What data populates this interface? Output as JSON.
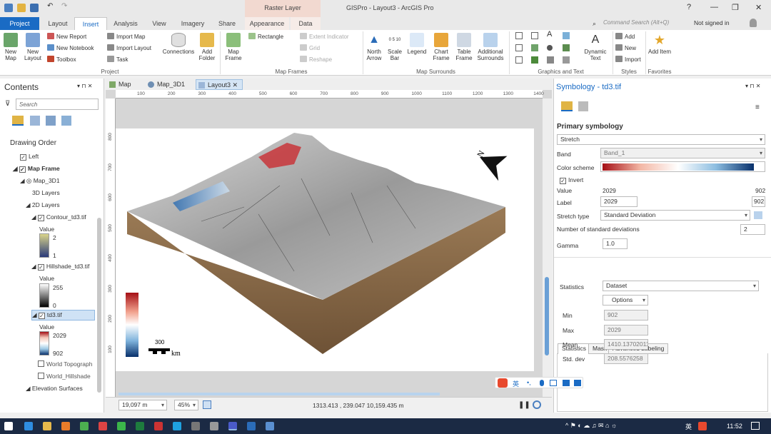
{
  "window": {
    "title": "GISPro - Layout3 - ArcGIS Pro",
    "contextual_tab_group": "Raster Layer",
    "help": "?",
    "signin": "Not signed in"
  },
  "tabs": [
    "Project",
    "Layout",
    "Insert",
    "Analysis",
    "View",
    "Imagery",
    "Share",
    "Appearance",
    "Data"
  ],
  "active_tab": "Insert",
  "command_search": {
    "placeholder": "Command Search (Alt+Q)"
  },
  "ribbon": {
    "project": {
      "new_map": "New Map",
      "new_layout": "New Layout",
      "new_report": "New Report",
      "new_notebook": "New Notebook",
      "toolbox": "Toolbox",
      "import_map": "Import Map",
      "import_layout": "Import Layout",
      "task": "Task",
      "connections": "Connections",
      "add_folder": "Add Folder",
      "group": "Project"
    },
    "map_frames": {
      "map_frame": "Map Frame",
      "rectangle": "Rectangle",
      "extent_indicator": "Extent Indicator",
      "grid": "Grid",
      "reshape": "Reshape",
      "group": "Map Frames"
    },
    "map_surrounds": {
      "north_arrow": "North Arrow",
      "scale_bar": "Scale Bar",
      "scale_bar_ticks": "0 5 10",
      "legend": "Legend",
      "chart_frame": "Chart Frame",
      "table_frame": "Table Frame",
      "additional_surrounds": "Additional Surrounds",
      "group": "Map Surrounds"
    },
    "graphics": {
      "dynamic_text": "Dynamic Text",
      "text_glyph": "A",
      "group": "Graphics and Text"
    },
    "styles": {
      "add": "Add",
      "new": "New",
      "import": "Import",
      "group": "Styles"
    },
    "favorites": {
      "add_item": "Add Item",
      "group": "Favorites"
    }
  },
  "contents": {
    "title": "Contents",
    "search_placeholder": "Search",
    "drawing_order": "Drawing Order",
    "items": {
      "left": "Left",
      "map_frame": "Map Frame",
      "map_3d1": "Map_3D1",
      "layers_3d": "3D Layers",
      "layers_2d": "2D Layers",
      "contour": "Contour_td3.tif",
      "contour_value": "Value",
      "contour_max": "2",
      "contour_min": "1",
      "hillshade": "Hillshade_td3.tif",
      "hillshade_value": "Value",
      "hillshade_max": "255",
      "hillshade_min": "0",
      "td3": "td3.tif",
      "td3_value": "Value",
      "td3_max": "2029",
      "td3_min": "902",
      "world_topo": "World Topograph",
      "world_hillshade": "World_Hillshade",
      "elevation": "Elevation Surfaces"
    }
  },
  "view_tabs": [
    "Map",
    "Map_3D1",
    "Layout3"
  ],
  "rulers": {
    "h": [
      "100",
      "200",
      "300",
      "400",
      "500",
      "600",
      "700",
      "800",
      "900",
      "1000",
      "1100",
      "1200",
      "1300",
      "1400"
    ],
    "v": [
      "800",
      "700",
      "600",
      "500",
      "400",
      "300",
      "200",
      "100"
    ]
  },
  "layout": {
    "north_label": "N",
    "scale_label": "300",
    "scale_unit": "km"
  },
  "status": {
    "scale": "19,097 m",
    "zoom": "45%",
    "coords": "1313.413 , 239.047  10,159.435 m"
  },
  "symbology": {
    "title": "Symbology - td3.tif",
    "primary": "Primary symbology",
    "renderer": "Stretch",
    "band_label": "Band",
    "band": "Band_1",
    "color_scheme_label": "Color scheme",
    "invert_label": "Invert",
    "value_label": "Value",
    "value_high": "2029",
    "value_low": "902",
    "label_label": "Label",
    "label_high": "2029",
    "label_low": "902",
    "stretch_type_label": "Stretch type",
    "stretch_type": "Standard Deviation",
    "num_std_label": "Number of standard deviations",
    "num_std": "2",
    "gamma_label": "Gamma",
    "gamma": "1.0",
    "tabs": [
      "Statistics",
      "Mask",
      "Advanced Labeling"
    ],
    "statistics_label": "Statistics",
    "statistics": "Dataset",
    "options": "Options",
    "min_label": "Min",
    "min": "902",
    "max_label": "Max",
    "max": "2029",
    "mean_label": "Mean",
    "mean": "1410.13702011",
    "std_label": "Std. dev",
    "std": "208.5576258"
  },
  "ime": {
    "lang": "英"
  },
  "taskbar": {
    "clock": "11:52",
    "ime": "英"
  },
  "colors": {
    "accent": "#1a6bc4",
    "ramp_high": "#a50f15",
    "ramp_low": "#08306b"
  }
}
